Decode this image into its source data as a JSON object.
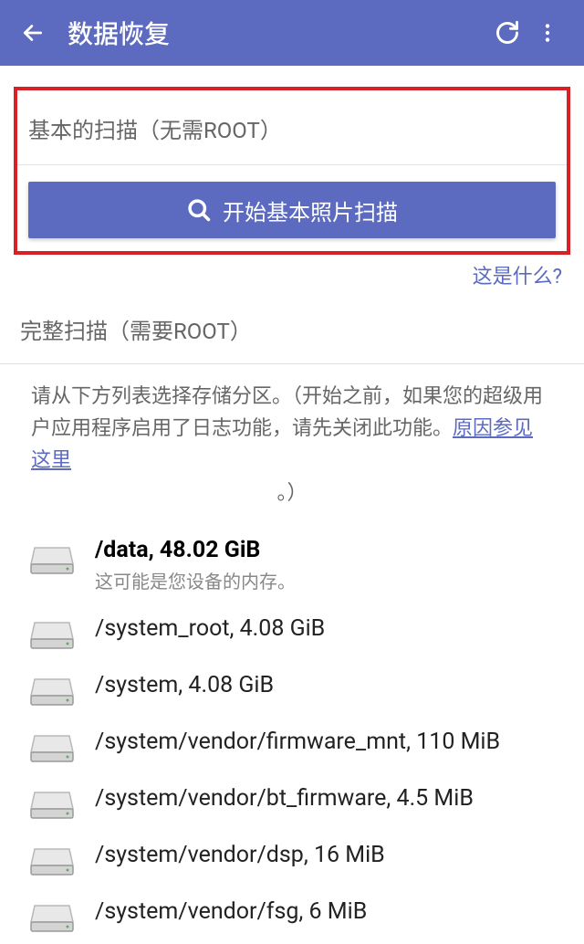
{
  "appbar": {
    "title": "数据恢复"
  },
  "basic": {
    "header": "基本的扫描（无需ROOT）",
    "button_label": "开始基本照片扫描",
    "what_link": "这是什么?"
  },
  "full": {
    "header": "完整扫描（需要ROOT）",
    "hint_p1": "请从下方列表选择存储分区。（开始之前，如果您的超级用户应用程序启用了日志功能，请先关闭此功能。",
    "hint_link": "原因参见这里",
    "hint_p2": "。）"
  },
  "partitions": [
    {
      "title": "/data, 48.02 GiB",
      "sub": "这可能是您设备的内存。",
      "bold": true
    },
    {
      "title": "/system_root, 4.08 GiB",
      "sub": "",
      "bold": false
    },
    {
      "title": "/system, 4.08 GiB",
      "sub": "",
      "bold": false
    },
    {
      "title": "/system/vendor/firmware_mnt, 110 MiB",
      "sub": "",
      "bold": false
    },
    {
      "title": "/system/vendor/bt_firmware, 4.5 MiB",
      "sub": "",
      "bold": false
    },
    {
      "title": "/system/vendor/dsp, 16 MiB",
      "sub": "",
      "bold": false
    },
    {
      "title": "/system/vendor/fsg, 6 MiB",
      "sub": "",
      "bold": false
    }
  ]
}
